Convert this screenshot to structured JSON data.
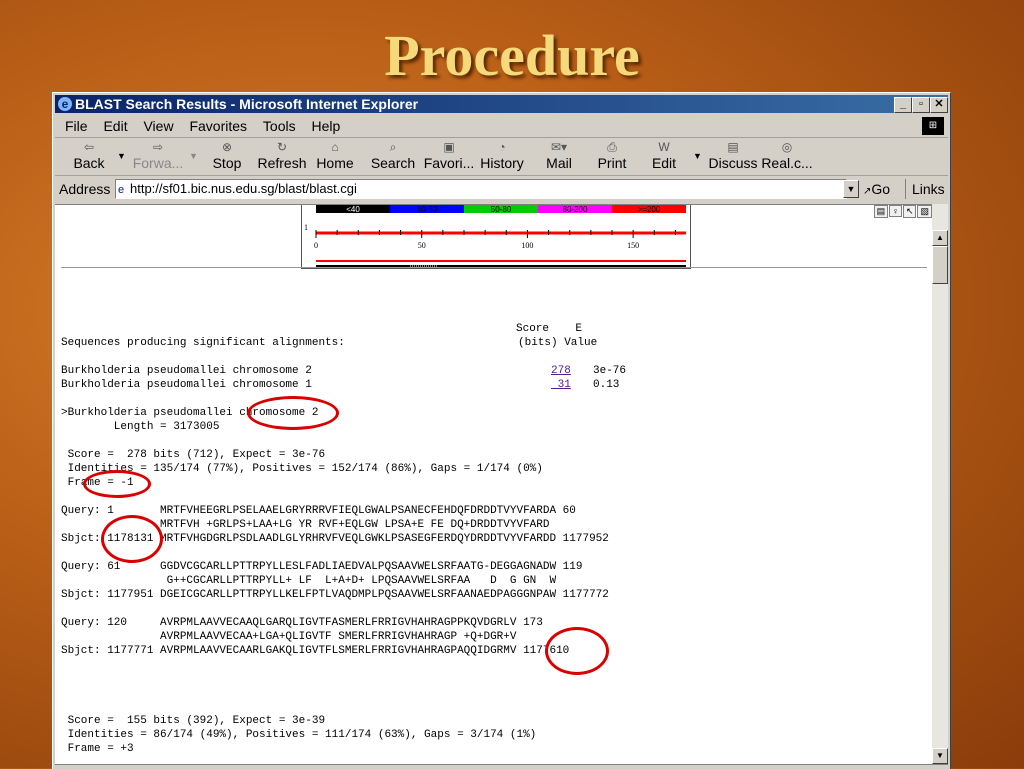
{
  "slide": {
    "title": "Procedure"
  },
  "window": {
    "title": "BLAST Search Results - Microsoft Internet Explorer",
    "controls": {
      "minimize": "_",
      "maximize": "▫",
      "close": "✕"
    }
  },
  "menu": [
    "File",
    "Edit",
    "View",
    "Favorites",
    "Tools",
    "Help"
  ],
  "toolbar": {
    "back": "Back",
    "forward": "Forwa...",
    "stop": "Stop",
    "refresh": "Refresh",
    "home": "Home",
    "search": "Search",
    "favorites": "Favori...",
    "history": "History",
    "mail": "Mail",
    "print": "Print",
    "edit": "Edit",
    "discuss": "Discuss",
    "realc": "Real.c..."
  },
  "address": {
    "label": "Address",
    "url": "http://sf01.bic.nus.edu.sg/blast/blast.cgi",
    "go": "Go",
    "links": "Links"
  },
  "graphic": {
    "legend": [
      "<40",
      "40-50",
      "50-80",
      "80-200",
      ">=200"
    ],
    "legend_colors": [
      "#000000",
      "#0000ff",
      "#00cc00",
      "#ff00ff",
      "#ff0000"
    ],
    "axis_label": "1",
    "ticks": [
      "0",
      "50",
      "100",
      "150"
    ]
  },
  "results": {
    "header_score": "Score    E",
    "header_line": "Sequences producing significant alignments:",
    "header_units": "(bits) Value",
    "hits": [
      {
        "name": "Burkholderia pseudomallei chromosome 2",
        "score": "278",
        "evalue": "3e-76"
      },
      {
        "name": "Burkholderia pseudomallei chromosome 1",
        "score": " 31",
        "evalue": "0.13"
      }
    ],
    "alignment_head": ">Burkholderia pseudomallei chromosome 2",
    "length": "        Length = 3173005",
    "hsp1": [
      " Score =  278 bits (712), Expect = 3e-76",
      " Identities = 135/174 (77%), Positives = 152/174 (86%), Gaps = 1/174 (0%)",
      " Frame = -1"
    ],
    "blocks": [
      [
        "Query: 1       MRTFVHEEGRLPSELAAELGRYRRRVFIEQLGWALPSANECFEHDQFDRDDTVYVFARDA 60",
        "               MRTFVH +GRLPS+LAA+LG YR RVF+EQLGW LPSA+E FE DQ+DRDDTVYVFARD",
        "Sbjct: 1178131 MRTFVHGDGRLPSDLAADLGLYRHRVFVEQLGWKLPSASEGFERDQYDRDDTVYVFARDD 1177952"
      ],
      [
        "Query: 61      GGDVCGCARLLPTTRPYLLESLFADLIAEDVALPQSAAVWELSRFAATG-DEGGAGNADW 119",
        "                G++CGCARLLPTTRPYLL+ LF  L+A+D+ LPQSAAVWELSRFAA   D  G GN  W",
        "Sbjct: 1177951 DGEICGCARLLPTTRPYLLKELFPTLVAQDMPLPQSAAVWELSRFAANAEDPAGGGNPAW 1177772"
      ],
      [
        "Query: 120     AVRPMLAAVVECAAQLGARQLIGVTFASMERLFRRIGVHAHRAGPPKQVDGRLV 173",
        "               AVRPMLAAVVECAA+LGA+QLIGVTF SMERLFRRIGVHAHRAGP +Q+DGR+V",
        "Sbjct: 1177771 AVRPMLAAVVECAARLGAKQLIGVTFLSMERLFRRIGVHAHRAGPAQQIDGRMV 1177610"
      ]
    ],
    "hsp2": [
      " Score =  155 bits (392), Expect = 3e-39",
      " Identities = 86/174 (49%), Positives = 111/174 (63%), Gaps = 3/174 (1%)",
      " Frame = +3"
    ]
  }
}
